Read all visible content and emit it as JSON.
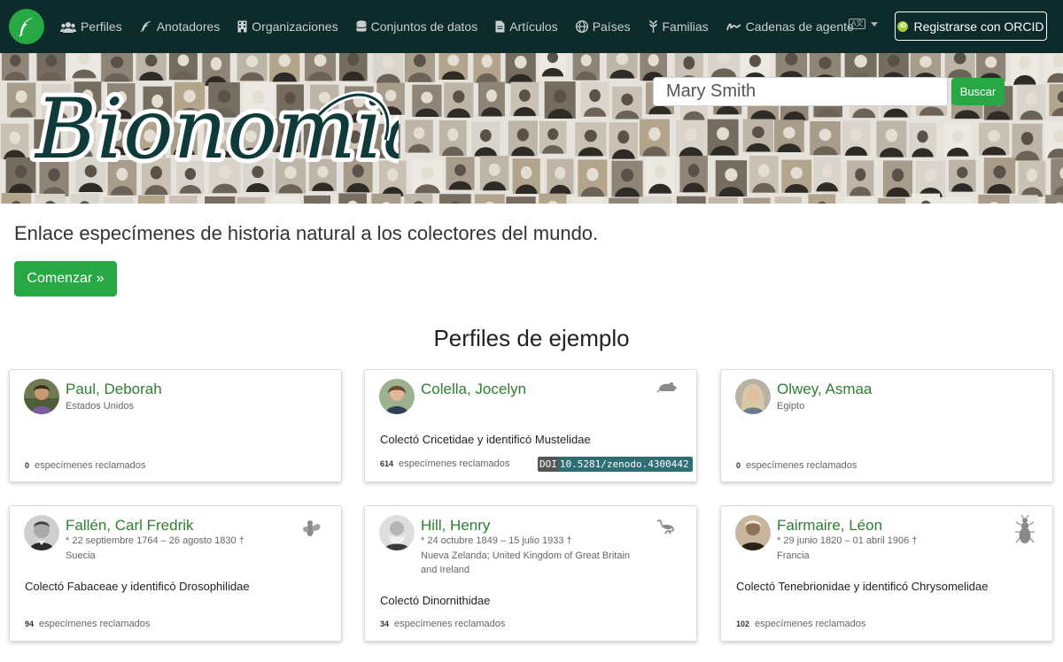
{
  "nav": {
    "items": [
      {
        "label": "Perfiles",
        "icon": "users-icon"
      },
      {
        "label": "Anotadores",
        "icon": "feather-icon"
      },
      {
        "label": "Organizaciones",
        "icon": "building-icon"
      },
      {
        "label": "Conjuntos de datos",
        "icon": "database-icon"
      },
      {
        "label": "Artículos",
        "icon": "file-icon"
      },
      {
        "label": "Países",
        "icon": "globe-icon"
      },
      {
        "label": "Familias",
        "icon": "leaf-icon"
      },
      {
        "label": "Cadenas de agente",
        "icon": "signature-icon"
      }
    ],
    "language_icon_text": "A文",
    "orcid_label": "Registrarse con ORCID",
    "orcid_icon_text": "iD"
  },
  "banner": {
    "logo_text": "Bionomia",
    "search_value": "Mary Smith",
    "search_button": "Buscar"
  },
  "intro": {
    "tagline": "Enlace especímenes de historia natural a los colectores del mundo.",
    "start_button": "Comenzar »"
  },
  "section_title": "Perfiles de ejemplo",
  "profiles": [
    {
      "name": "Paul, Deborah",
      "country": "Estados Unidos",
      "dates": "",
      "description": "",
      "count": "0",
      "count_label": "especímenes reclamados",
      "taxon_icon": ""
    },
    {
      "name": "Colella, Jocelyn",
      "country": "",
      "dates": "",
      "description": "Colectó Cricetidae y identificó Mustelidae",
      "count": "614",
      "count_label": "especímenes reclamados",
      "taxon_icon": "rodent-icon",
      "doi_label": "DOI",
      "doi_value": "10.5281/zenodo.4300442"
    },
    {
      "name": "Olwey, Asmaa",
      "country": "Egipto",
      "dates": "",
      "description": "",
      "count": "0",
      "count_label": "especímenes reclamados",
      "taxon_icon": ""
    },
    {
      "name": "Fallén, Carl Fredrik",
      "dates": "* 22 septiembre 1764 – 26 agosto 1830 †",
      "country": "Suecia",
      "description": "Colectó Fabaceae y identificó Drosophilidae",
      "count": "94",
      "count_label": "especímenes reclamados",
      "taxon_icon": "fly-icon"
    },
    {
      "name": "Hill, Henry",
      "dates": "* 24 octubre 1849 – 15 julio 1933 †",
      "country": "Nueva Zelanda; United Kingdom of Great Britain",
      "country2": "and Ireland",
      "description": "Colectó Dinornithidae",
      "count": "34",
      "count_label": "especímenes reclamados",
      "taxon_icon": "moa-icon"
    },
    {
      "name": "Fairmaire, Léon",
      "dates": "* 29 junio 1820 – 01 abril 1906 †",
      "country": "Francia",
      "description": "Colectó Tenebrionidae y identificó Chrysomelidae",
      "count": "102",
      "count_label": "especímenes reclamados",
      "taxon_icon": "beetle-icon"
    }
  ]
}
